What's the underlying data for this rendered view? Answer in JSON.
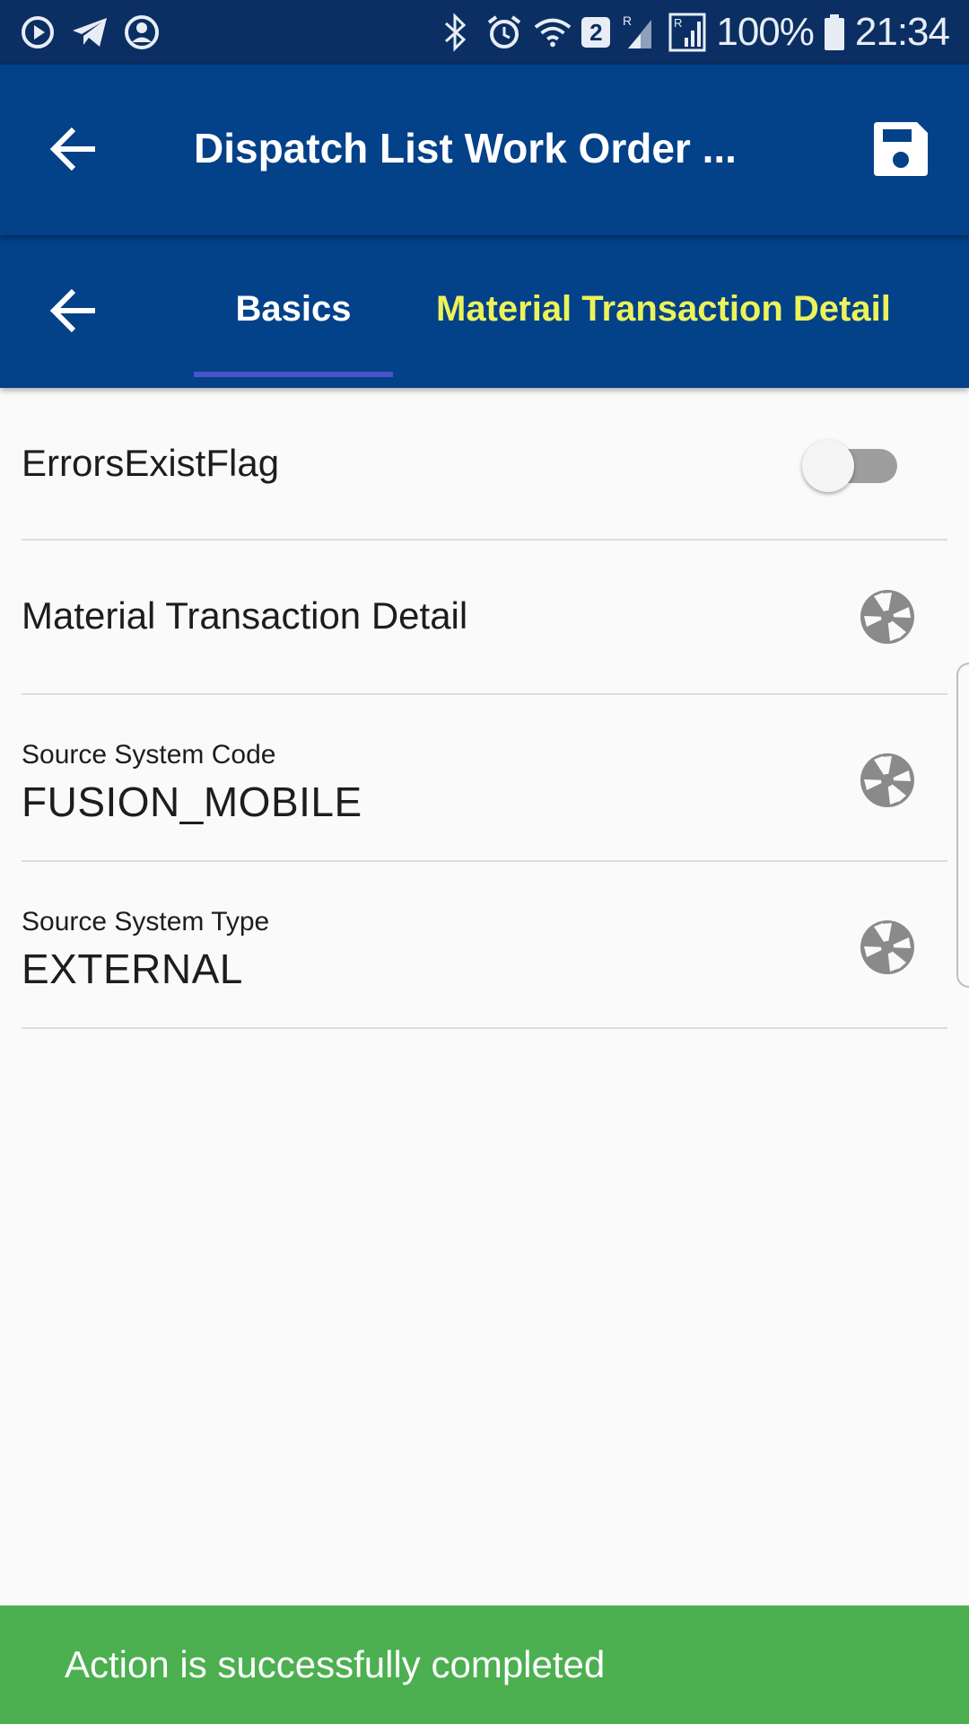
{
  "status_bar": {
    "battery_percent": "100%",
    "time": "21:34",
    "sim_badge": "2",
    "icons_left": [
      "media-play-icon",
      "telegram-icon",
      "account-icon"
    ],
    "icons_right": [
      "bluetooth-icon",
      "alarm-icon",
      "wifi-icon",
      "signal-icon",
      "roaming-signal-icon",
      "battery-icon"
    ]
  },
  "appbar": {
    "title": "Dispatch List Work Order ...",
    "back_icon": "arrow-left-icon",
    "save_icon": "save-icon"
  },
  "tabs": {
    "back_icon": "arrow-left-icon",
    "items": [
      {
        "label": "Basics",
        "selected": true
      },
      {
        "label": "Material Transaction Detail",
        "selected": false
      }
    ]
  },
  "form": {
    "errors_flag": {
      "label": "ErrorsExistFlag",
      "value": false
    },
    "material_detail": {
      "label": "Material Transaction Detail",
      "icon": "aperture-icon"
    },
    "source_system_code": {
      "label": "Source System Code",
      "value": "FUSION_MOBILE",
      "icon": "aperture-icon"
    },
    "source_system_type": {
      "label": "Source System Type",
      "value": "EXTERNAL",
      "icon": "aperture-icon"
    }
  },
  "colors": {
    "status_bar": "#0b2f63",
    "primary": "#034189",
    "tab_highlight": "#ecf35a",
    "tab_indicator": "#4a55c8",
    "snackbar": "#4caf50"
  },
  "snackbar": {
    "message": "Action is successfully completed"
  }
}
